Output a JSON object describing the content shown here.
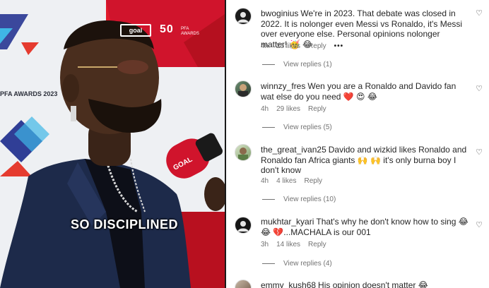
{
  "video": {
    "caption": "SO DISCIPLINED",
    "sponsor_logo_box": "goal",
    "sponsor_50": "50",
    "sponsor_50_sub": "PFA AWARDS",
    "backdrop_mark": "PFA AWARDS 2023",
    "mic_label": "GOAL"
  },
  "comments": [
    {
      "username": "bwoginius",
      "text": "We're in 2023. That debate was closed in 2022. It is nolonger even Messi vs Ronaldo, it's Messi over everyone else. Personal opinions nolonger matter! 🥳 😂",
      "time": "4h",
      "likes": "25 likes",
      "reply": "Reply",
      "more": "•••",
      "view_replies": "View replies (1)",
      "avatar_icon": "dark-profile-avatar"
    },
    {
      "username": "winnzy_fres",
      "text": "Wen you are a Ronaldo and Davido fan wat else do you need ❤️ 😍 😂",
      "time": "4h",
      "likes": "29 likes",
      "reply": "Reply",
      "view_replies": "View replies (5)",
      "avatar_icon": "photo-avatar"
    },
    {
      "username": "the_great_ivan25",
      "text": "Davido and wizkid likes Ronaldo and Ronaldo fan Africa giants 🙌 🙌  it's only burna boy I don't know",
      "time": "4h",
      "likes": "4 likes",
      "reply": "Reply",
      "view_replies": "View replies (10)",
      "avatar_icon": "photo-avatar"
    },
    {
      "username": "mukhtar_kyari",
      "text": "That's why he don't know how to sing 😂 😂 💔...MACHALA is our 001",
      "time": "3h",
      "likes": "14 likes",
      "reply": "Reply",
      "view_replies": "View replies (4)",
      "avatar_icon": "dark-profile-avatar"
    },
    {
      "username": "emmy_kush68",
      "text": "His opinion doesn't matter 😂",
      "avatar_icon": "photo-avatar"
    }
  ],
  "colors": {
    "text": "#262626",
    "muted": "#737373",
    "heart_red": "#e0245e",
    "mic_red": "#d0142c",
    "suit_navy": "#1d2a4a"
  }
}
